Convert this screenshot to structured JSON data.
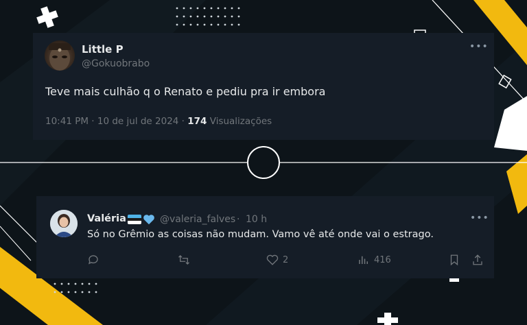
{
  "tweet": {
    "display_name": "Little P",
    "handle": "@Gokuobrabo",
    "text": "Teve mais culhão q o Renato e pediu pra ir embora",
    "time": "10:41 PM",
    "date": "10 de jul de 2024",
    "views_count": "174",
    "views_label": "Visualizações",
    "more_icon": "more-dots-icon"
  },
  "reply": {
    "display_name": "Valéria",
    "handle": "@valeria_falves",
    "time_ago": "10 h",
    "text": "Só no Grêmio as coisas não mudam. Vamo vê até onde vai o estrago.",
    "likes": "2",
    "views": "416",
    "flag_colors": [
      "#4fb3e8",
      "#1c1c1c",
      "#ffffff"
    ],
    "heart_badge_color": "#6ab8ec"
  },
  "colors": {
    "accent_yellow": "#f2b90f",
    "card_bg": "#151d27",
    "background": "#0d1419"
  }
}
